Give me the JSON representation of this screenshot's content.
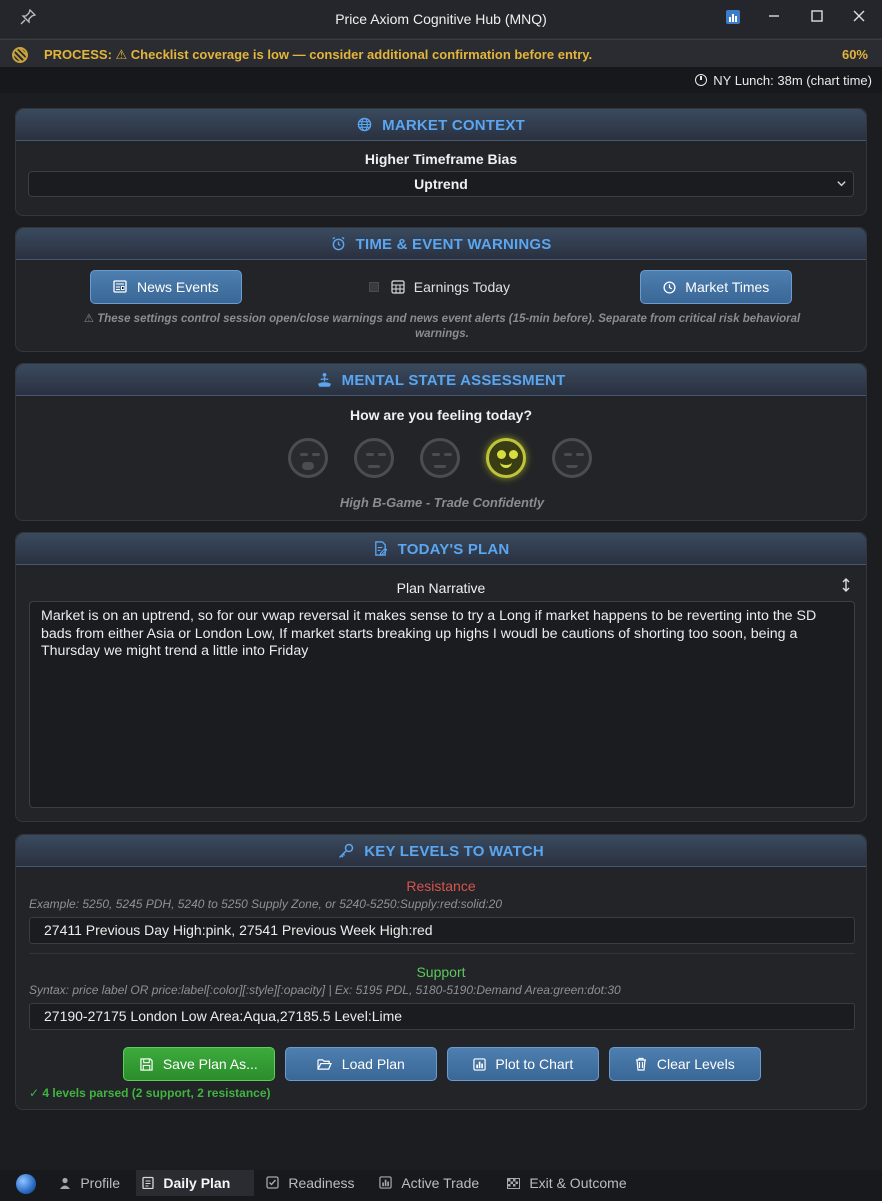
{
  "window": {
    "title": "Price Axiom Cognitive Hub (MNQ)"
  },
  "process_warning": {
    "text": "PROCESS: ⚠ Checklist coverage is low — consider additional confirmation before entry.",
    "percent": "60%"
  },
  "session_time": {
    "text": "NY Lunch: 38m (chart time)"
  },
  "market_context": {
    "title": "MARKET CONTEXT",
    "bias_label": "Higher Timeframe Bias",
    "bias_value": "Uptrend"
  },
  "time_events": {
    "title": "TIME & EVENT WARNINGS",
    "news_button": "News Events",
    "earnings_label": "Earnings Today",
    "market_times_button": "Market Times",
    "note": "⚠ These settings control session open/close warnings and news event alerts (15-min before). Separate from critical risk behavioral warnings."
  },
  "mental_state": {
    "title": "MENTAL STATE ASSESSMENT",
    "question": "How are you feeling today?",
    "selected_index": 3,
    "status": "High B-Game - Trade Confidently"
  },
  "todays_plan": {
    "title": "TODAY'S PLAN",
    "narrative_label": "Plan Narrative",
    "narrative": "Market is on an uptrend, so for our vwap reversal it makes sense to try a Long if market happens to be reverting into the SD bads from either Asia or London Low, If market starts breaking up highs I woudl be cautions of shorting too soon,  being a Thursday we might trend a little into Friday"
  },
  "key_levels": {
    "title": "KEY LEVELS TO WATCH",
    "resistance_label": "Resistance",
    "resistance_hint": "Example: 5250, 5245 PDH, 5240 to 5250 Supply Zone, or 5240-5250:Supply:red:solid:20",
    "resistance_value": "27411 Previous Day High:pink, 27541 Previous Week High:red",
    "support_label": "Support",
    "support_hint": "Syntax: price label OR price:label[:color][:style][:opacity]  |  Ex: 5195 PDL, 5180-5190:Demand Area:green:dot:30",
    "support_value": "27190-27175 London Low Area:Aqua,27185.5 Level:Lime",
    "save_button": "Save Plan As...",
    "load_button": "Load Plan",
    "plot_button": "Plot to Chart",
    "clear_button": "Clear Levels",
    "parsed_status": "✓ 4 levels parsed (2 support, 2 resistance)"
  },
  "tabs": [
    "Profile",
    "Daily Plan",
    "Readiness",
    "Active Trade",
    "Exit & Outcome"
  ],
  "colors": {
    "accent": "#5aa6f0",
    "warning": "#e3b53a",
    "resistance": "#d9534f",
    "support": "#5cc85c"
  }
}
